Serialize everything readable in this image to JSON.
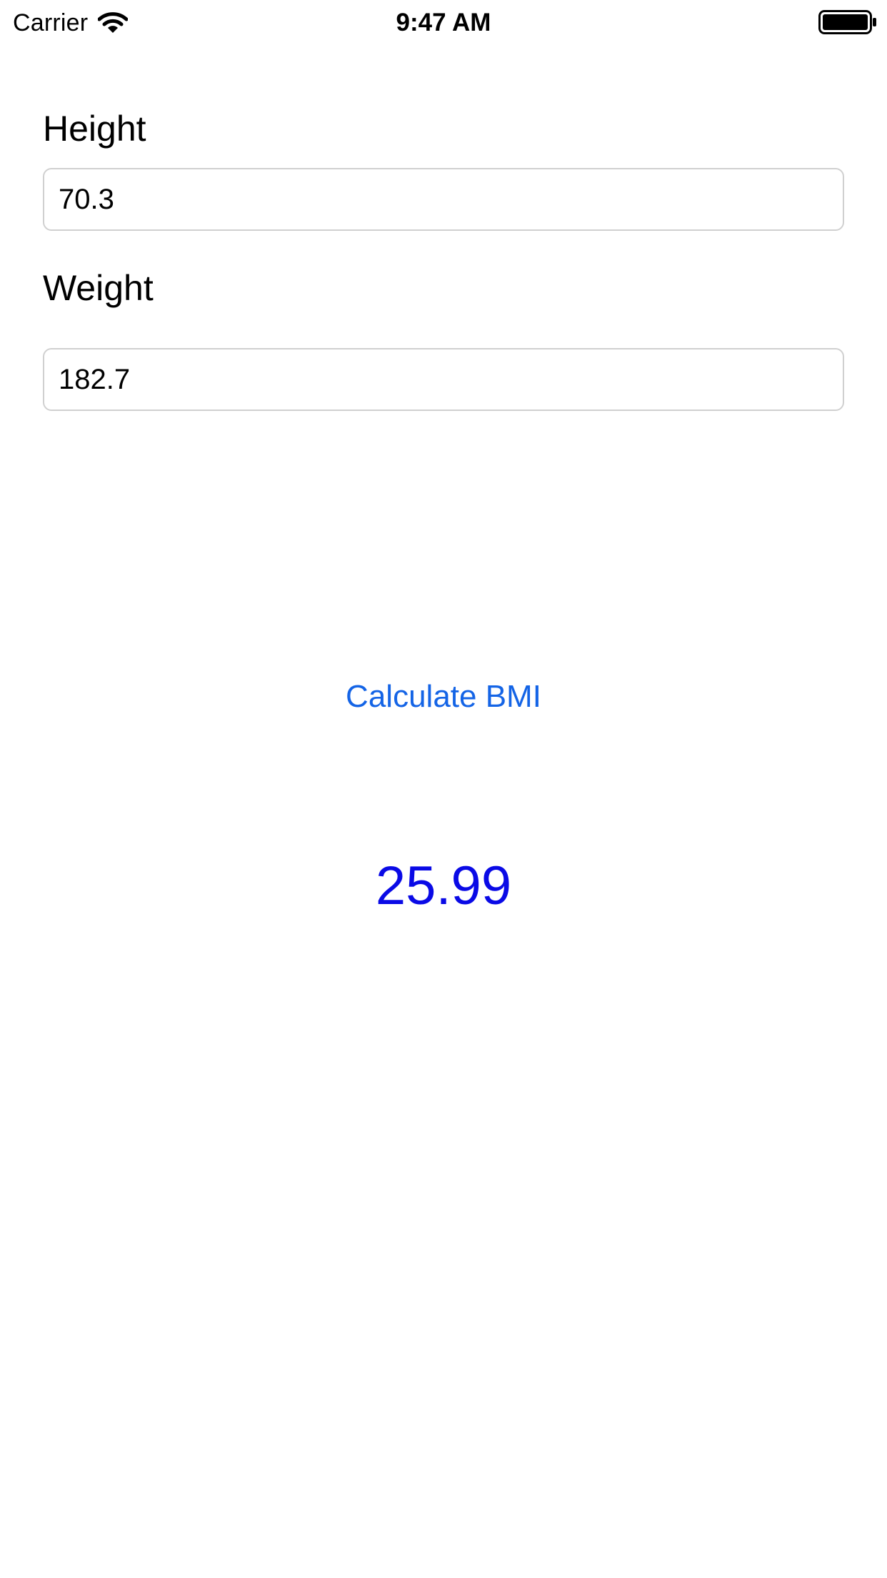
{
  "status_bar": {
    "carrier": "Carrier",
    "time": "9:47 AM",
    "wifi_icon": "wifi-icon",
    "battery_icon": "battery-icon"
  },
  "form": {
    "height_label": "Height",
    "height_value": "70.3",
    "weight_label": "Weight",
    "weight_value": "182.7"
  },
  "actions": {
    "calculate_label": "Calculate BMI"
  },
  "result": {
    "bmi_value": "25.99"
  },
  "colors": {
    "button_text": "#1464e6",
    "result_text": "#0a0ae6",
    "field_border": "#d0d0d0",
    "background": "#ffffff"
  }
}
